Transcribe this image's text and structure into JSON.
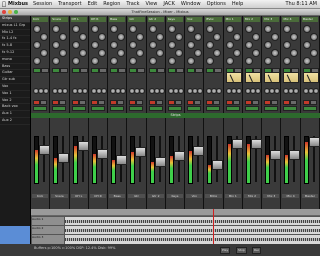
{
  "menubar": {
    "app": "Mixbus",
    "items": [
      "Session",
      "Transport",
      "Edit",
      "Region",
      "Track",
      "View",
      "JACK",
      "Window",
      "Options",
      "Help"
    ],
    "clock": "Thu 8:11 AM"
  },
  "window": {
    "title": "ThatFineSession - Mixer - Mixbus"
  },
  "sidebar": {
    "items": [
      "Strips",
      "mixus L1 Grp",
      "Mix L2",
      "fx 1-4 fx",
      "fx 5-8",
      "fx 9-12",
      "mono",
      "Bass",
      "Guitar",
      "Gtr sub",
      "Vox",
      "Vox 1",
      "Vox 2",
      "Back vox",
      "Aux 1",
      "Aux 2"
    ]
  },
  "mixer": {
    "strip_names": [
      "Kick",
      "Snare",
      "OH L",
      "OH R",
      "Bass",
      "Gtr",
      "Gtr 2",
      "Keys",
      "Vox",
      "BVox",
      "Mix 1",
      "Mix 2",
      "Mix 3",
      "Mix 4",
      "Master"
    ],
    "mix_tab": "Strips",
    "colors": {
      "name_bg": "#4a6b3a",
      "meter_peak": "#d0352a",
      "meter_mid": "#e8c23a",
      "meter_low": "#3fcf4a",
      "vu_face": "#f3e3a8"
    }
  },
  "editor": {
    "tracks": [
      {
        "name": "Audio 1"
      },
      {
        "name": "Audio 2"
      },
      {
        "name": "Audio 3"
      }
    ]
  },
  "status": {
    "text": "Buffers p:100% c:100%   DSP: 12.4%   Disk: 99%",
    "buttons": [
      "Play",
      "Stop",
      "Rec"
    ]
  }
}
